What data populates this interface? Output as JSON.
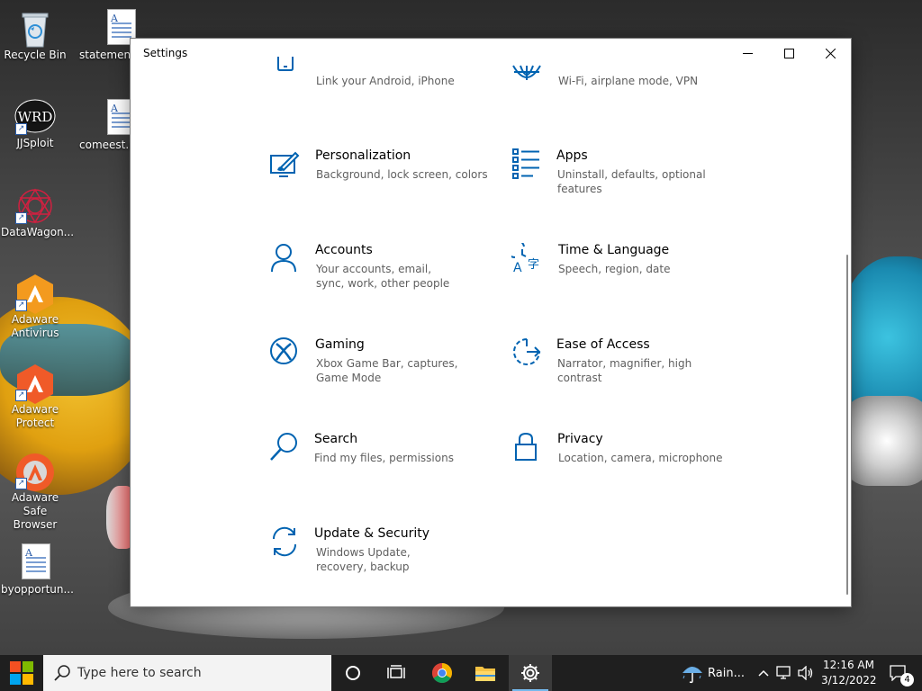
{
  "desktop": {
    "icons": [
      {
        "label": "Recycle Bin"
      },
      {
        "label": "statemento..."
      },
      {
        "label": "JJSploit",
        "art": "WRD"
      },
      {
        "label": "comeest.rtf"
      },
      {
        "label": "DataWagon..."
      },
      {
        "label": "Adaware Antivirus"
      },
      {
        "label": "Adaware Protect"
      },
      {
        "label": "Adaware Safe Browser"
      },
      {
        "label": "byopportun..."
      }
    ]
  },
  "window": {
    "title": "Settings",
    "tiles": [
      {
        "title": "",
        "desc": "Link your Android, iPhone",
        "icon": "phone-icon"
      },
      {
        "title": "",
        "desc": "Wi-Fi, airplane mode, VPN",
        "icon": "globe-icon"
      },
      {
        "title": "Personalization",
        "desc": "Background, lock screen, colors",
        "icon": "personalization-icon"
      },
      {
        "title": "Apps",
        "desc": "Uninstall, defaults, optional features",
        "icon": "apps-icon"
      },
      {
        "title": "Accounts",
        "desc": "Your accounts, email, sync, work, other people",
        "icon": "person-icon"
      },
      {
        "title": "Time & Language",
        "desc": "Speech, region, date",
        "icon": "time-language-icon"
      },
      {
        "title": "Gaming",
        "desc": "Xbox Game Bar, captures, Game Mode",
        "icon": "xbox-icon"
      },
      {
        "title": "Ease of Access",
        "desc": "Narrator, magnifier, high contrast",
        "icon": "ease-of-access-icon"
      },
      {
        "title": "Search",
        "desc": "Find my files, permissions",
        "icon": "search-icon"
      },
      {
        "title": "Privacy",
        "desc": "Location, camera, microphone",
        "icon": "lock-icon"
      },
      {
        "title": "Update & Security",
        "desc": "Windows Update, recovery, backup",
        "icon": "update-icon"
      }
    ]
  },
  "taskbar": {
    "search_placeholder": "Type here to search",
    "weather": "Rain...",
    "time": "12:16 AM",
    "date": "3/12/2022",
    "notification_count": "4"
  },
  "colors": {
    "accent": "#0063b1",
    "taskbar": "#1f1f1f"
  }
}
